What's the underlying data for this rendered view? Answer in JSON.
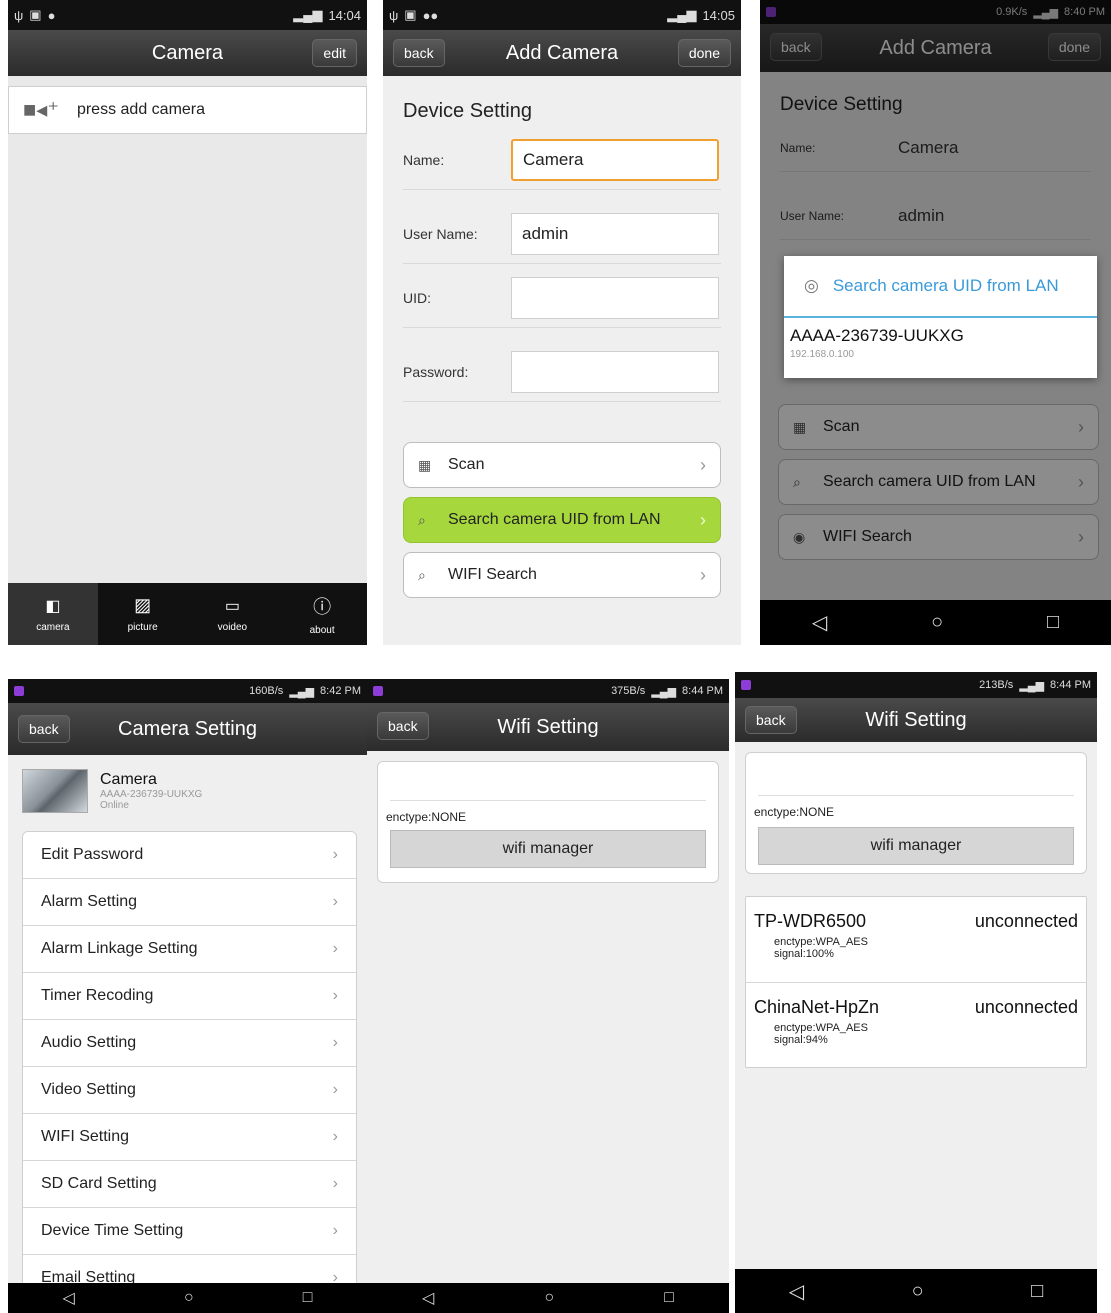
{
  "screen1": {
    "status_time": "14:04",
    "title": "Camera",
    "edit_label": "edit",
    "add_camera_text": "press add camera",
    "tabs": [
      {
        "label": "camera",
        "icon": "camera-icon"
      },
      {
        "label": "picture",
        "icon": "picture-icon"
      },
      {
        "label": "voideo",
        "icon": "video-icon"
      },
      {
        "label": "about",
        "icon": "about-icon"
      }
    ]
  },
  "screen2": {
    "status_time": "14:05",
    "title": "Add Camera",
    "back_label": "back",
    "done_label": "done",
    "section_title": "Device Setting",
    "fields": [
      {
        "label": "Name:",
        "value": "Camera"
      },
      {
        "label": "User Name:",
        "value": "admin"
      },
      {
        "label": "UID:",
        "value": ""
      },
      {
        "label": "Password:",
        "value": ""
      }
    ],
    "buttons": [
      "Scan",
      "Search camera UID from LAN",
      "WIFI Search"
    ]
  },
  "screen3": {
    "status_text": "0.9K/s",
    "status_time": "8:40 PM",
    "title": "Add Camera",
    "back_label": "back",
    "done_label": "done",
    "section_title": "Device Setting",
    "name_label": "Name:",
    "name_value": "Camera",
    "user_label": "User Name:",
    "user_value": "admin",
    "dialog_title": "Search camera UID from LAN",
    "dialog_uid": "AAAA-236739-UUKXG",
    "dialog_ip": "192.168.0.100",
    "buttons": [
      "Scan",
      "Search camera UID from LAN",
      "WIFI Search"
    ]
  },
  "screen4": {
    "status_text": "160B/s",
    "status_time": "8:42 PM",
    "title": "Camera Setting",
    "back_label": "back",
    "camera_name": "Camera",
    "camera_uid": "AAAA-236739-UUKXG",
    "camera_status": "Online",
    "menu": [
      "Edit Password",
      "Alarm Setting",
      "Alarm Linkage Setting",
      "Timer Recoding",
      "Audio Setting",
      "Video Setting",
      "WIFI Setting",
      "SD Card Setting",
      "Device Time Setting",
      "Email Setting"
    ]
  },
  "screen5": {
    "status_text": "375B/s",
    "status_time": "8:44 PM",
    "title": "Wifi Setting",
    "back_label": "back",
    "enctype": "enctype:NONE",
    "wifi_manager": "wifi manager"
  },
  "screen6": {
    "status_text": "213B/s",
    "status_time": "8:44 PM",
    "title": "Wifi Setting",
    "back_label": "back",
    "enctype": "enctype:NONE",
    "wifi_manager": "wifi manager",
    "networks": [
      {
        "ssid": "TP-WDR6500",
        "state": "unconnected",
        "enctype": "enctype:WPA_AES",
        "signal": "signal:100%"
      },
      {
        "ssid": "ChinaNet-HpZn",
        "state": "unconnected",
        "enctype": "enctype:WPA_AES",
        "signal": "signal:94%"
      }
    ]
  }
}
